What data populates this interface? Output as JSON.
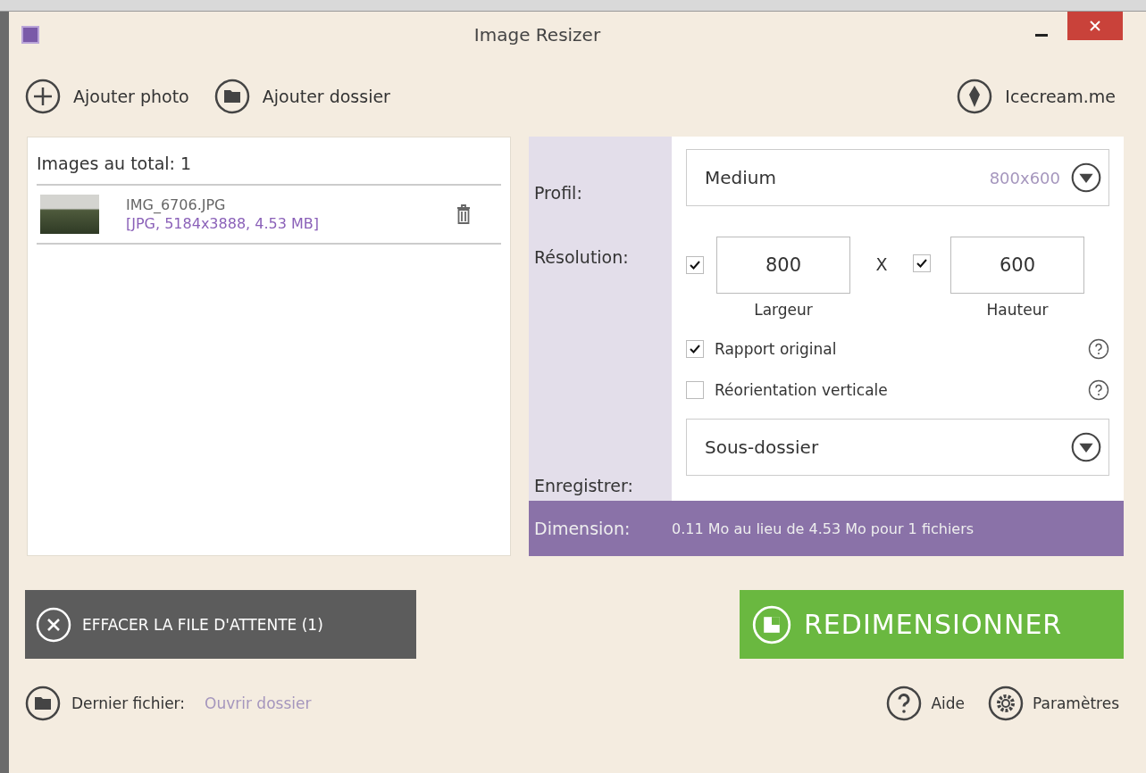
{
  "window": {
    "title": "Image Resizer"
  },
  "toolbar": {
    "add_photo": "Ajouter photo",
    "add_folder": "Ajouter dossier",
    "site_link": "Icecream.me"
  },
  "queue": {
    "total_label": "Images au total: 1",
    "files": [
      {
        "name": "IMG_6706.JPG",
        "info": "[JPG, 5184x3888, 4.53 MB]"
      }
    ]
  },
  "settings": {
    "profile_label": "Profil:",
    "profile_value": "Medium",
    "profile_size": "800x600",
    "resolution_label": "Résolution:",
    "width": {
      "value": "800",
      "label": "Largeur",
      "checked": true
    },
    "separator": "X",
    "height": {
      "value": "600",
      "label": "Hauteur",
      "checked": true
    },
    "options": [
      {
        "label": "Rapport original",
        "checked": true
      },
      {
        "label": "Réorientation verticale",
        "checked": false
      }
    ],
    "save_label": "Enregistrer:",
    "save_value": "Sous-dossier",
    "dimension_label": "Dimension:",
    "dimension_value": "0.11 Mo au lieu de 4.53 Mo pour 1 fichiers"
  },
  "clear_button": "EFFACER LA FILE D'ATTENTE (1)",
  "resize_button": "REDIMENSIONNER",
  "footer": {
    "last_file_label": "Dernier fichier:",
    "open_folder": "Ouvrir dossier",
    "help": "Aide",
    "settings": "Paramètres"
  }
}
